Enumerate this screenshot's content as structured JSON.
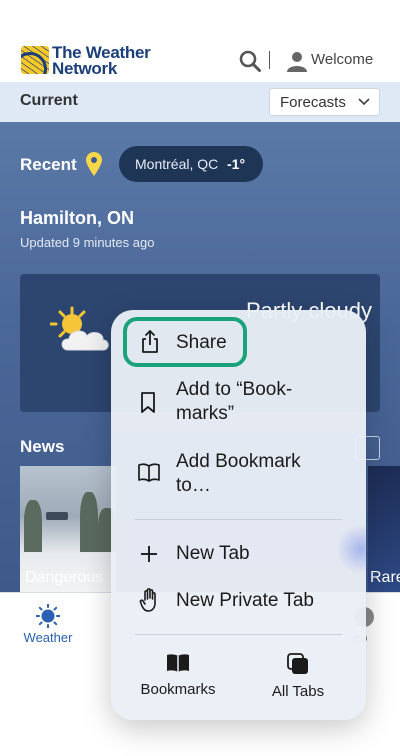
{
  "header": {
    "logo_line1": "The Weather",
    "logo_line2": "Network",
    "welcome_label": "Welcome"
  },
  "current_bar": {
    "title": "Current",
    "forecasts_label": "Forecasts"
  },
  "recent": {
    "label": "Recent",
    "location_name": "Montréal, QC",
    "location_temp": "-1°"
  },
  "location": {
    "city": "Hamilton, ON",
    "updated": "Updated 9 minutes ago"
  },
  "conditions": {
    "text": "Partly cloudy"
  },
  "news": {
    "title": "News",
    "items": [
      {
        "caption": "Dangerous"
      },
      {
        "caption": "Rare"
      }
    ]
  },
  "bottom_nav": {
    "weather_label": "Weather",
    "video_label_fragment": "eo"
  },
  "context_menu": {
    "items": [
      {
        "label": "Share",
        "icon": "share-icon"
      },
      {
        "label_line1": "Add to “Book-",
        "label_line2": "marks”",
        "icon": "bookmark-icon"
      },
      {
        "label_line1": "Add Bookmark",
        "label_line2": "to…",
        "icon": "book-icon"
      },
      {
        "label": "New Tab",
        "icon": "plus-icon"
      },
      {
        "label": "New Private Tab",
        "icon": "hand-icon"
      }
    ],
    "bottom_tabs": [
      {
        "label": "Bookmarks",
        "icon": "book-icon"
      },
      {
        "label": "All Tabs",
        "icon": "tabs-icon"
      }
    ],
    "highlight_color": "#1aa37a"
  },
  "colors": {
    "brand_blue": "#1c3f7a",
    "brand_yellow": "#f7c928",
    "panel_blue": "#4b689a"
  }
}
